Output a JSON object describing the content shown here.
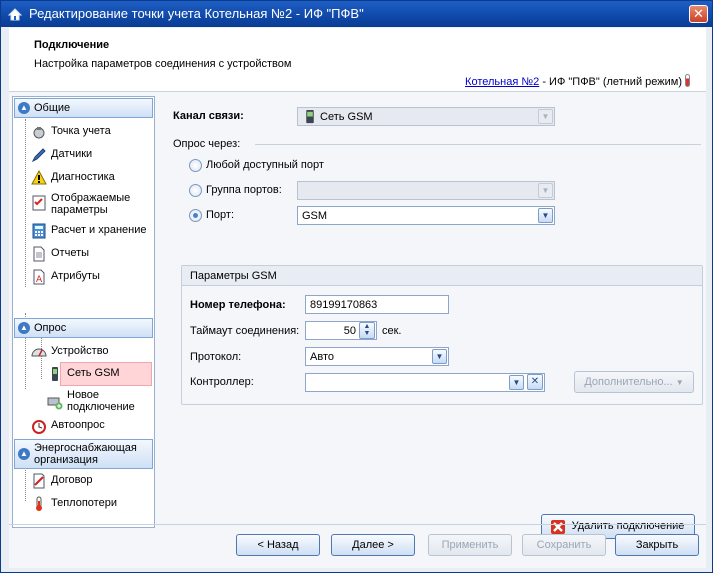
{
  "window": {
    "title": "Редактирование точки учета Котельная №2 - ИФ \"ПФВ\"",
    "close_symbol": "✕"
  },
  "header": {
    "title": "Подключение",
    "subtitle": "Настройка параметров соединения с устройством",
    "link_text": "Котельная №2",
    "link_suffix": " - ИФ \"ПФВ\" (летний режим)"
  },
  "sidebar": {
    "groups": {
      "general": "Общие",
      "poll": "Опрос",
      "energy": "Энергоснабжающая организация"
    },
    "items": {
      "metering_point": "Точка учета",
      "sensors": "Датчики",
      "diagnostics": "Диагностика",
      "displayed_params": "Отображаемые параметры",
      "calc_storage": "Расчет и хранение",
      "reports": "Отчеты",
      "attributes": "Атрибуты",
      "device": "Устройство",
      "gsm_network": "Сеть GSM",
      "new_connection": "Новое подключение",
      "autopoll": "Автоопрос",
      "contract": "Договор",
      "heat_loss": "Теплопотери"
    }
  },
  "form": {
    "channel_label": "Канал связи:",
    "channel_value": "Сеть GSM",
    "poll_via_label": "Опрос через:",
    "radio_any": "Любой доступный порт",
    "radio_group": "Группа портов:",
    "radio_group_value": "",
    "radio_port": "Порт:",
    "port_value": "GSM",
    "selected_radio": "port",
    "gsm_panel_title": "Параметры GSM",
    "phone_label": "Номер телефона:",
    "phone_value": "89199170863",
    "timeout_label": "Таймаут соединения:",
    "timeout_value": "50",
    "timeout_unit": "сек.",
    "protocol_label": "Протокол:",
    "protocol_value": "Авто",
    "controller_label": "Контроллер:",
    "controller_value": "",
    "more_button": "Дополнительно...",
    "delete_button": "Удалить подключение"
  },
  "footer": {
    "back": "< Назад",
    "next": "Далее >",
    "apply": "Применить",
    "save": "Сохранить",
    "close": "Закрыть"
  },
  "icons": {
    "title": "app-window-icon",
    "dropdown": "chevron-down-icon"
  }
}
